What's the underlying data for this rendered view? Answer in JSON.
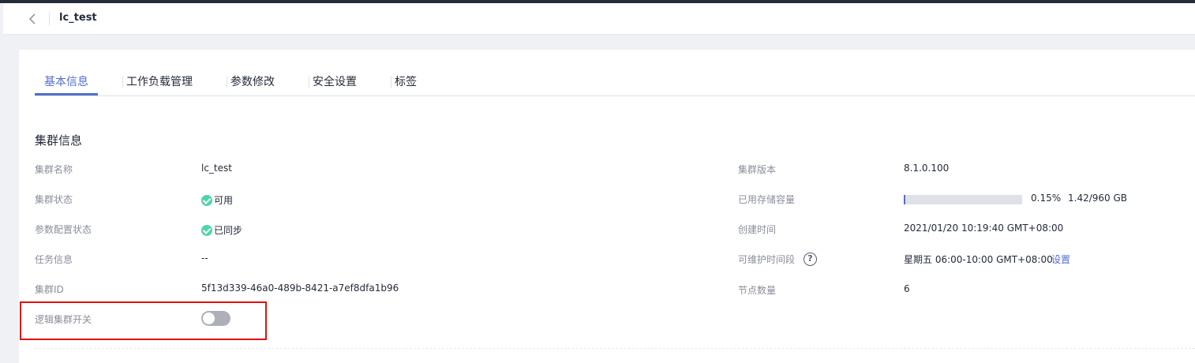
{
  "header": {
    "title": "lc_test"
  },
  "tabs": [
    {
      "label": "基本信息"
    },
    {
      "label": "工作负载管理"
    },
    {
      "label": "参数修改"
    },
    {
      "label": "安全设置"
    },
    {
      "label": "标签"
    }
  ],
  "section": {
    "title": "集群信息"
  },
  "left_fields": {
    "name": {
      "label": "集群名称",
      "value": "lc_test"
    },
    "status": {
      "label": "集群状态",
      "value": "可用"
    },
    "param_status": {
      "label": "参数配置状态",
      "value": "已同步"
    },
    "task": {
      "label": "任务信息",
      "value": "--"
    },
    "id": {
      "label": "集群ID",
      "value": "5f13d339-46a0-489b-8421-a7ef8dfa1b96"
    },
    "logical_switch": {
      "label": "逻辑集群开关",
      "enabled": false
    }
  },
  "right_fields": {
    "version": {
      "label": "集群版本",
      "value": "8.1.0.100"
    },
    "storage": {
      "label": "已用存储容量",
      "percent_text": "0.15%",
      "usage": "1.42/960 GB",
      "fraction": 0.0015
    },
    "created": {
      "label": "创建时间",
      "value": "2021/01/20 10:19:40 GMT+08:00"
    },
    "maintenance": {
      "label": "可维护时间段",
      "help_glyph": "?",
      "value": "星期五 06:00-10:00 GMT+08:00",
      "action": "设置"
    },
    "nodes": {
      "label": "节点数量",
      "value": "6"
    }
  },
  "colors": {
    "accent": "#526ecc",
    "success": "#50d4ab",
    "highlight": "#e30e0e"
  }
}
